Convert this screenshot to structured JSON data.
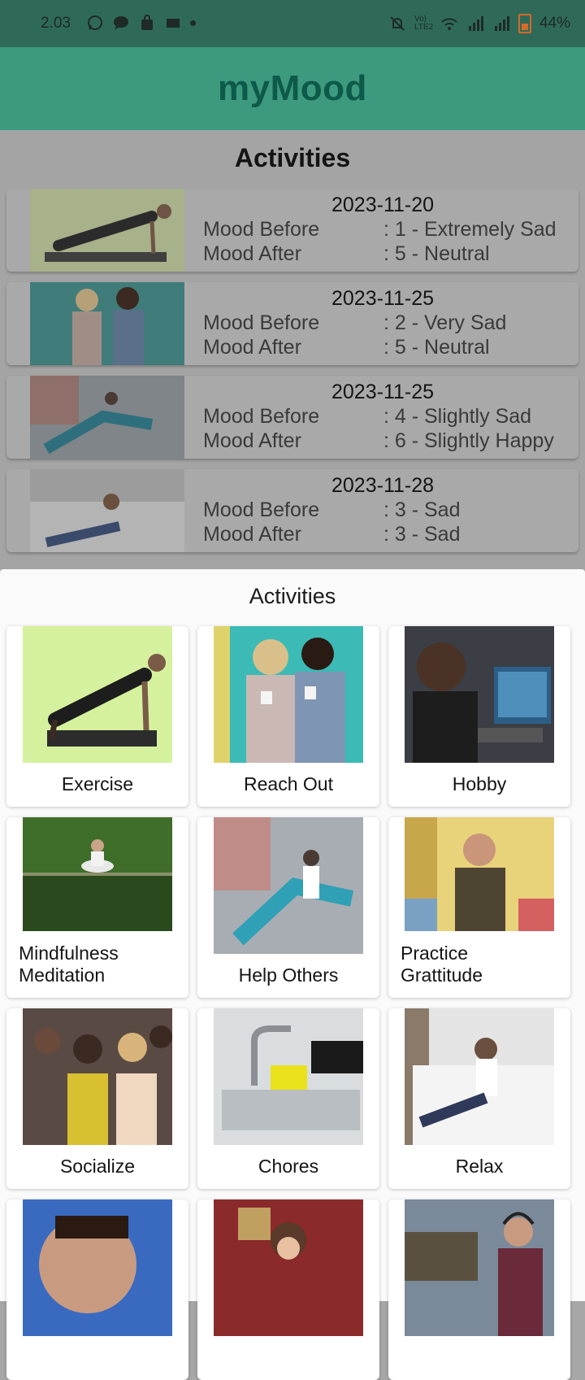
{
  "status_bar": {
    "time": "2.03",
    "battery": "44%",
    "network": "Vo) LTE2"
  },
  "app": {
    "title": "myMood"
  },
  "history": {
    "heading": "Activities",
    "entries": [
      {
        "date": "2023-11-20",
        "before_label": "Mood Before",
        "before_value": ": 1 - Extremely Sad",
        "after_label": "Mood After",
        "after_value": ": 5 - Neutral",
        "image": "exercise-gif"
      },
      {
        "date": "2023-11-25",
        "before_label": "Mood Before",
        "before_value": ": 2 - Very Sad",
        "after_label": "Mood After",
        "after_value": ": 5 - Neutral",
        "image": "reach-out-gif"
      },
      {
        "date": "2023-11-25",
        "before_label": "Mood Before",
        "before_value": ": 4 - Slightly Sad",
        "after_label": "Mood After",
        "after_value": ": 6 - Slightly Happy",
        "image": "help-others-gif"
      },
      {
        "date": "2023-11-28",
        "before_label": "Mood Before",
        "before_value": ": 3 - Sad",
        "after_label": "Mood After",
        "after_value": ": 3 - Sad",
        "image": "relax-gif"
      }
    ]
  },
  "sheet": {
    "heading": "Activities",
    "tiles": [
      {
        "label": "Exercise",
        "image": "exercise-gif"
      },
      {
        "label": "Reach Out",
        "image": "reach-out-gif"
      },
      {
        "label": "Hobby",
        "image": "hobby-gif"
      },
      {
        "label": "Mindfulness Meditation",
        "image": "meditation-gif"
      },
      {
        "label": "Help Others",
        "image": "help-others-gif"
      },
      {
        "label": "Practice Grattitude",
        "image": "gratitude-gif"
      },
      {
        "label": "Socialize",
        "image": "socialize-gif"
      },
      {
        "label": "Chores",
        "image": "chores-gif"
      },
      {
        "label": "Relax",
        "image": "relax-gif"
      },
      {
        "label": "",
        "image": "funny-face-gif"
      },
      {
        "label": "",
        "image": "girl-laughing-gif"
      },
      {
        "label": "",
        "image": "music-gif"
      }
    ]
  }
}
